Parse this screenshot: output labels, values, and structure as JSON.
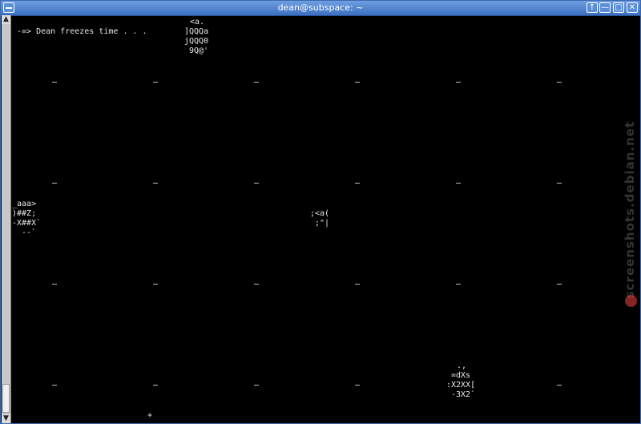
{
  "window": {
    "title": "dean@subspace: ~",
    "buttons": {
      "up": "↑",
      "minimize": "—",
      "maximize": "□",
      "close": "✕"
    }
  },
  "scrollbar": {
    "up_arrow": "▲",
    "down_arrow": "▼",
    "position_fraction": 0.98
  },
  "terminal": {
    "message": "-=> Dean freezes time . . .",
    "ascii_top": [
      "<a.",
      "]QQQa",
      "jQQQ0",
      "9Q@'"
    ],
    "ascii_left": [
      "_aaa>",
      ")##Z;",
      "-X##X`",
      "--`"
    ],
    "ascii_mid": [
      ";<a(",
      ";\"|"
    ],
    "ascii_bottom": [
      ".,",
      "=dXs",
      ":X2XX[",
      "-3X2`"
    ],
    "cursor": "+"
  },
  "watermark": "screenshots.debian.net",
  "icons": {
    "menu": "window-menu-icon",
    "watermark_logo": "debian-swirl-icon"
  }
}
